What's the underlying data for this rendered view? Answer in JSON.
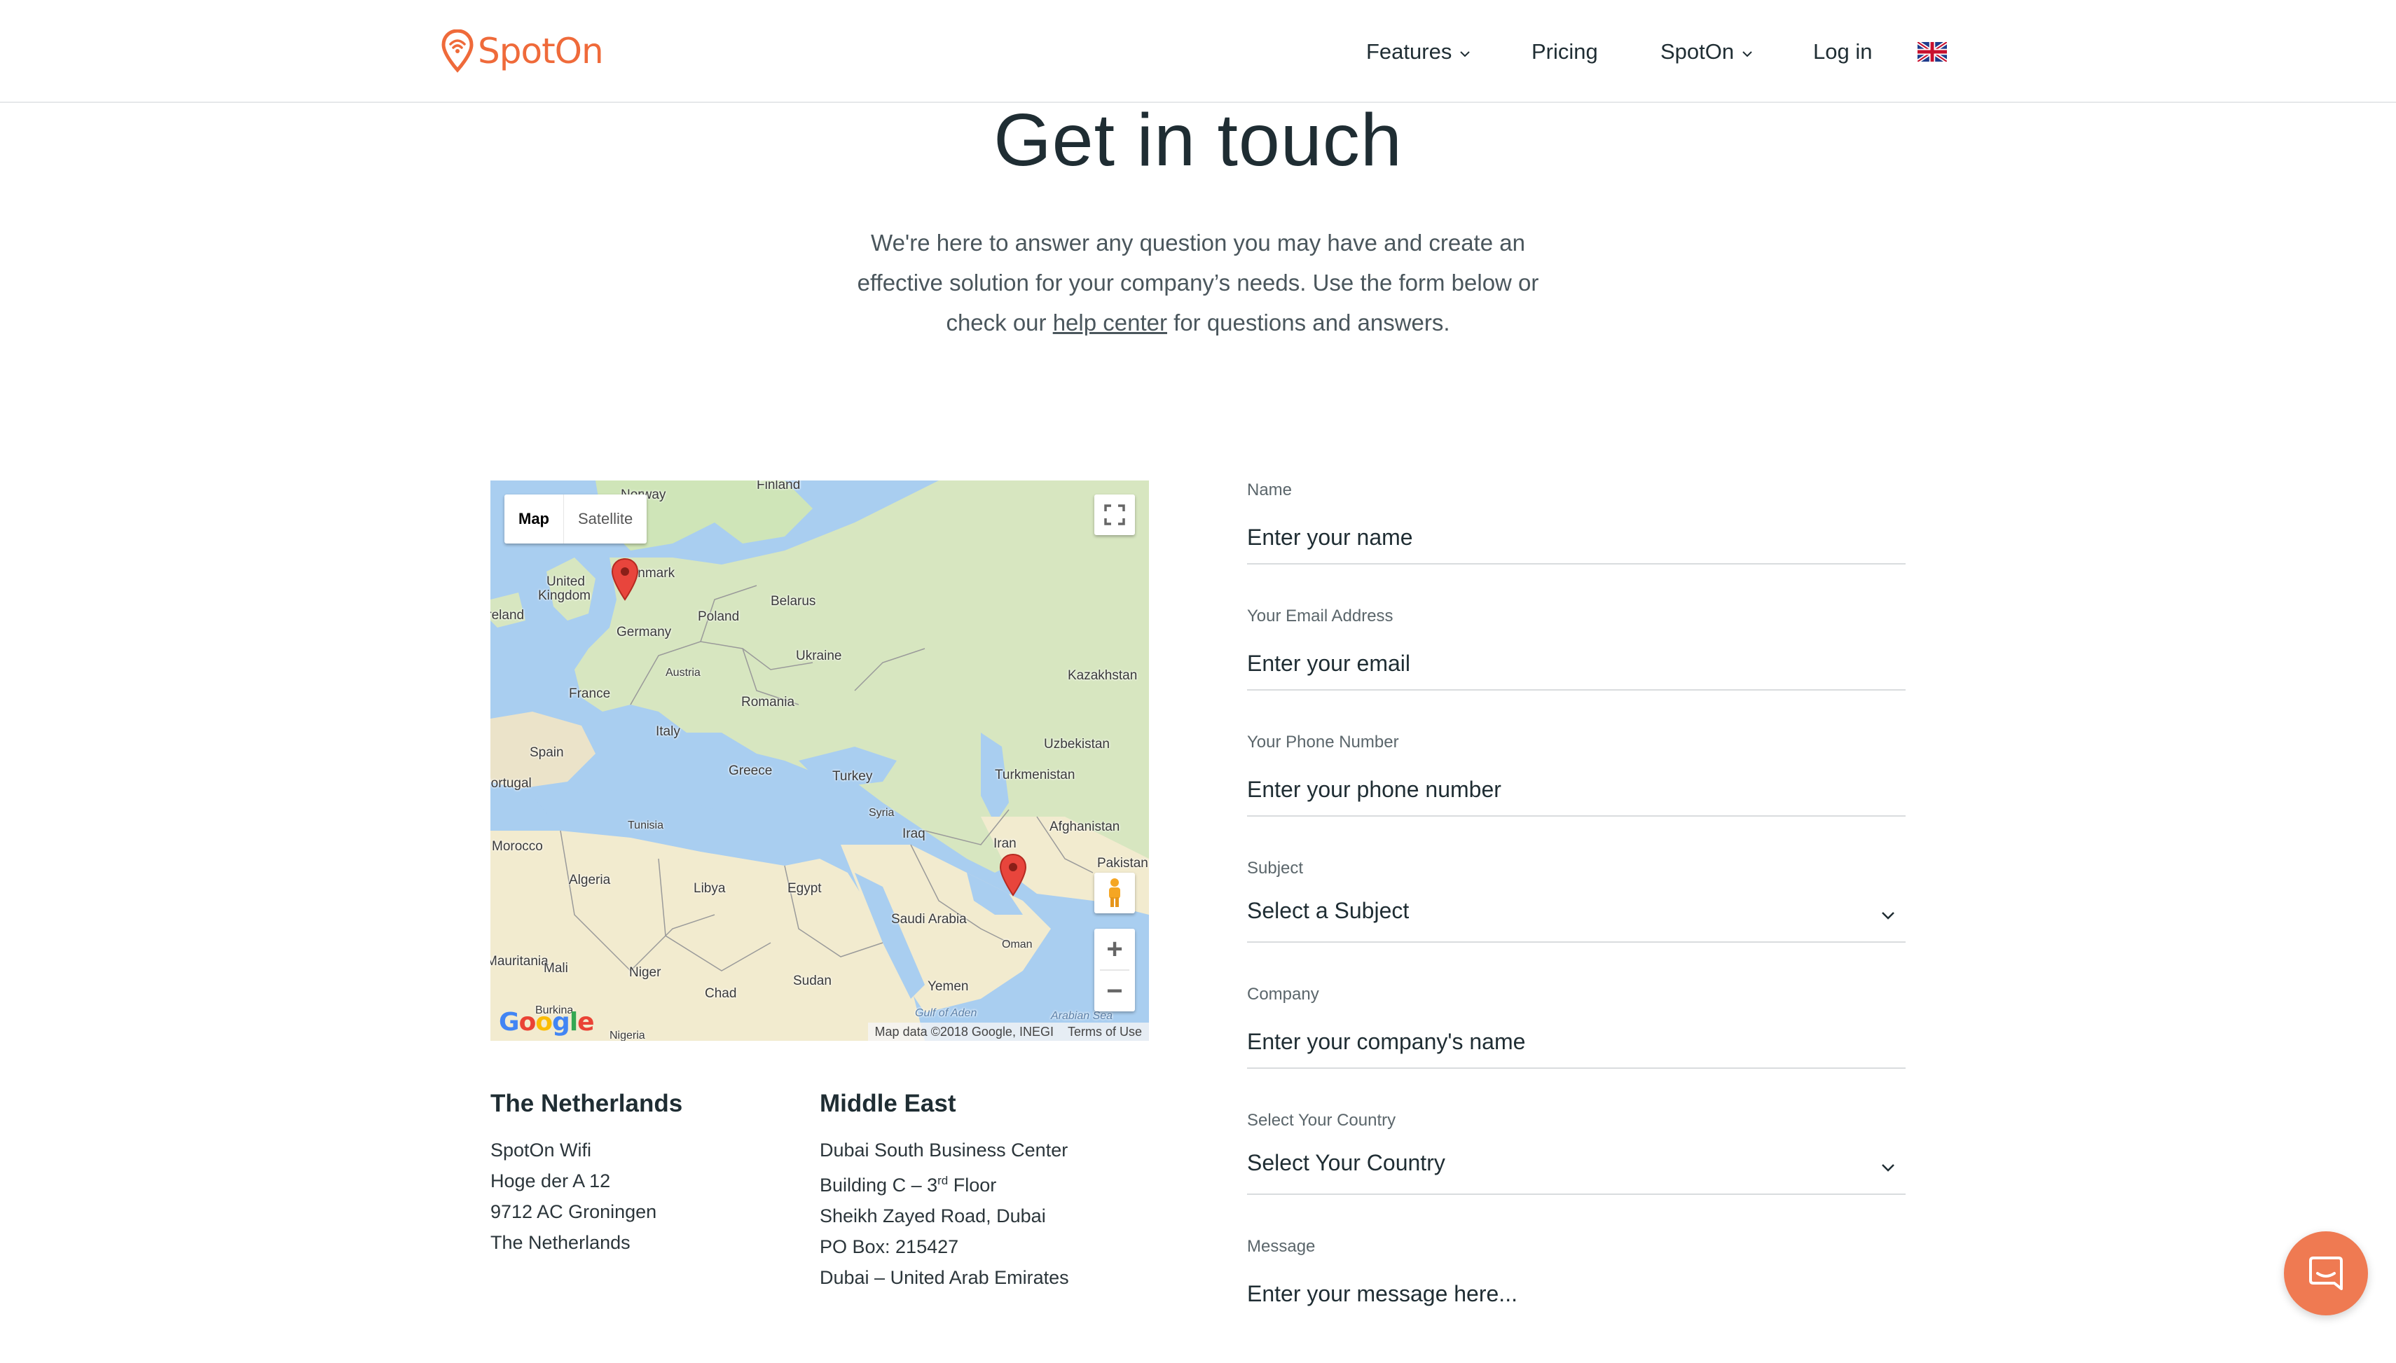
{
  "brand": {
    "name": "SpotOn",
    "color": "#ef6a3a"
  },
  "nav": {
    "features": "Features",
    "pricing": "Pricing",
    "spoton": "SpotOn",
    "login": "Log in",
    "language_icon": "uk-flag-icon"
  },
  "hero": {
    "title": "Get in touch",
    "text_before": "We're here to answer any question you may have and create an effective solution for your company’s needs. Use the form below or check our ",
    "link": "help center",
    "text_after": " for questions and answers."
  },
  "map": {
    "type_map": "Map",
    "type_satellite": "Satellite",
    "attribution": "Map data ©2018 Google, INEGI",
    "terms": "Terms of Use",
    "logo": "Google",
    "zoom_in": "+",
    "zoom_out": "−",
    "labels": [
      {
        "text": "Finland"
      },
      {
        "text": "Norway"
      },
      {
        "text": "United"
      },
      {
        "text": "Kingdom"
      },
      {
        "text": "Denmark"
      },
      {
        "text": "Ireland"
      },
      {
        "text": "Poland"
      },
      {
        "text": "Belarus"
      },
      {
        "text": "Germany"
      },
      {
        "text": "Ukraine"
      },
      {
        "text": "Austria"
      },
      {
        "text": "Kazakhstan"
      },
      {
        "text": "France"
      },
      {
        "text": "Romania"
      },
      {
        "text": "Italy"
      },
      {
        "text": "Uzbekistan"
      },
      {
        "text": "Spain"
      },
      {
        "text": "Portugal"
      },
      {
        "text": "Greece"
      },
      {
        "text": "Turkey"
      },
      {
        "text": "Turkmenistan"
      },
      {
        "text": "Syria"
      },
      {
        "text": "Tunisia"
      },
      {
        "text": "Iraq"
      },
      {
        "text": "Afghanistan"
      },
      {
        "text": "Morocco"
      },
      {
        "text": "Iran"
      },
      {
        "text": "Algeria"
      },
      {
        "text": "Libya"
      },
      {
        "text": "Egypt"
      },
      {
        "text": "Pakistan"
      },
      {
        "text": "Saudi Arabia"
      },
      {
        "text": "Mauritania"
      },
      {
        "text": "Mali"
      },
      {
        "text": "Niger"
      },
      {
        "text": "Oman"
      },
      {
        "text": "Chad"
      },
      {
        "text": "Sudan"
      },
      {
        "text": "Yemen"
      },
      {
        "text": "Gulf of Aden"
      },
      {
        "text": "Arabian Sea"
      },
      {
        "text": "Burkina"
      },
      {
        "text": "Nigeria"
      }
    ]
  },
  "offices": {
    "nl": {
      "title": "The Netherlands",
      "lines": [
        "SpotOn Wifi",
        "Hoge der A 12",
        "9712 AC Groningen",
        "The Netherlands"
      ]
    },
    "me": {
      "title": "Middle East",
      "line1": "Dubai South Business Center",
      "line2_pre": "Building C – 3",
      "line2_sup": "rd",
      "line2_post": " Floor",
      "line3": "Sheikh Zayed Road, Dubai",
      "line4": "PO Box: 215427",
      "line5": "Dubai – United Arab Emirates"
    }
  },
  "form": {
    "name_label": "Name",
    "name_placeholder": "Enter your name",
    "email_label": "Your Email Address",
    "email_placeholder": "Enter your email",
    "phone_label": "Your Phone Number",
    "phone_placeholder": "Enter your phone number",
    "subject_label": "Subject",
    "subject_value": "Select a Subject",
    "company_label": "Company",
    "company_placeholder": "Enter your company's name",
    "country_label": "Select Your Country",
    "country_value": "Select Your Country",
    "message_label": "Message",
    "message_placeholder": "Enter your message here..."
  },
  "chat": {
    "icon": "chat-bubble-icon",
    "color": "#ef7a52"
  }
}
